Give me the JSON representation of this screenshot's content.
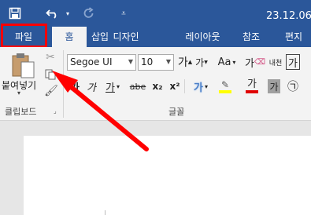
{
  "titlebar": {
    "doc_title": "23.12.06 월",
    "save_icon": "save-icon",
    "undo_icon": "undo-icon",
    "redo_icon": "redo-icon",
    "customize_icon": "customize-qat-icon"
  },
  "tabs": {
    "file": "파일",
    "home": "홈",
    "insert": "삽입",
    "design": "디자인",
    "layout": "레이아웃",
    "references": "참조",
    "mailings": "편지"
  },
  "clipboard": {
    "paste_label": "붙여넣기",
    "group_label": "클립보드"
  },
  "font": {
    "family": "Segoe UI",
    "size": "10",
    "grow": "가",
    "shrink": "가",
    "change_case": "Aa",
    "clear_format": "가",
    "phonetic": "내천",
    "char_border": "가",
    "bold": "가",
    "italic": "가",
    "underline": "가",
    "strike": "abe",
    "subscript": "x₂",
    "superscript": "x²",
    "font_color": "가",
    "char_shading": "가",
    "enclose": "㉠",
    "group_label": "글꼴"
  },
  "colors": {
    "title_bg": "#2b579a",
    "ribbon_bg": "#f3f3f3",
    "highlight": "#ffff00",
    "font_red": "#e00000",
    "annotation": "#ff0000"
  }
}
